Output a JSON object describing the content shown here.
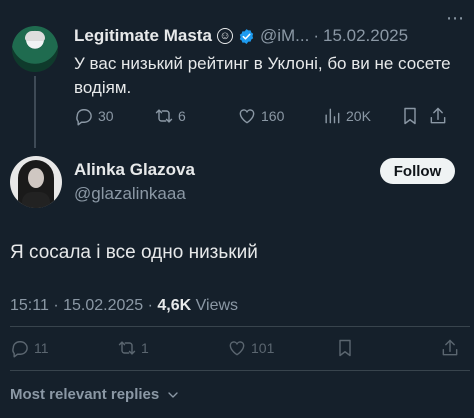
{
  "parent_tweet": {
    "author_name": "Legitimate Masta",
    "name_emoji": "☺",
    "handle": "@iM...",
    "separator": "·",
    "date": "15.02.2025",
    "text": "У вас низький рейтинг в Уклоні, бо ви не сосете водіям.",
    "replies": "30",
    "retweets": "6",
    "likes": "160",
    "views": "20K"
  },
  "main_tweet": {
    "author_name": "Alinka Glazova",
    "handle": "@glazalinkaaa",
    "follow_label": "Follow",
    "text": "Я сосала і все одно низький",
    "time": "15:11",
    "separator": "·",
    "date": "15.02.2025",
    "views_count": "4,6K",
    "views_label": "Views",
    "replies": "11",
    "retweets": "1",
    "likes": "101"
  },
  "replies_sort": {
    "label": "Most relevant replies"
  },
  "colors": {
    "background": "#15202b",
    "text_primary": "#e7e9ea",
    "text_secondary": "#8b98a5",
    "verified": "#1d9bf0",
    "follow_bg": "#eff3f4"
  }
}
